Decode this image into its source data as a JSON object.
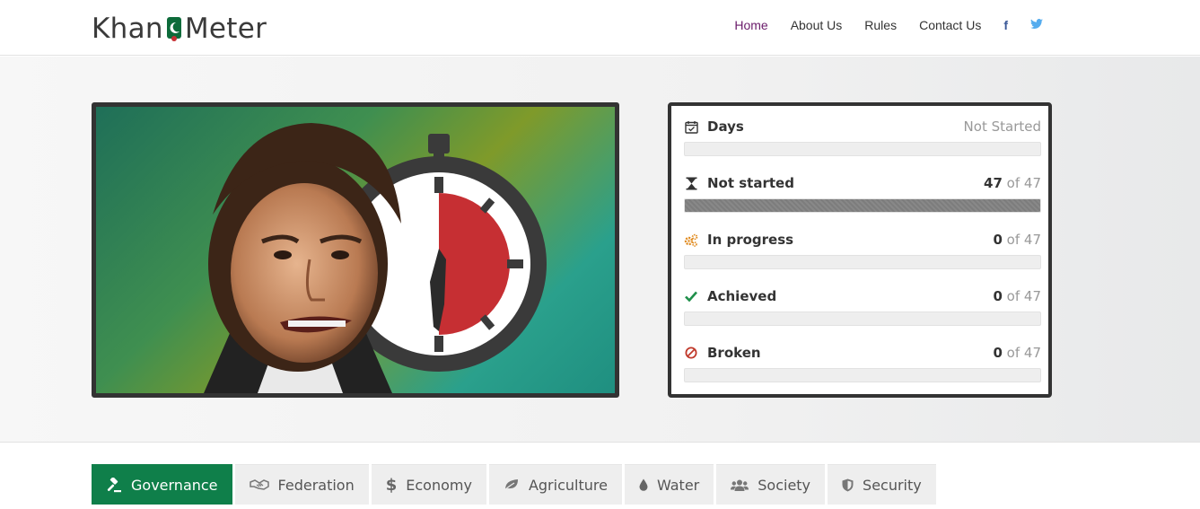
{
  "header": {
    "logo": {
      "left": "Khan",
      "right": "Meter"
    },
    "nav": [
      {
        "label": "Home",
        "active": true
      },
      {
        "label": "About Us",
        "active": false
      },
      {
        "label": "Rules",
        "active": false
      },
      {
        "label": "Contact Us",
        "active": false
      }
    ],
    "social": [
      {
        "glyph": "f",
        "icon": "facebook-icon",
        "color": "#3b5998"
      },
      {
        "glyph": "🐦",
        "icon": "twitter-icon",
        "color": "#55acee"
      }
    ]
  },
  "stats": {
    "days": {
      "label": "Days",
      "value": "Not Started",
      "icon": "calendar-icon",
      "progress": 0
    },
    "rows": [
      {
        "label": "Not started",
        "count": "47",
        "of": "of 47",
        "icon": "hourglass-icon",
        "color": "#333333",
        "progress": 1.0
      },
      {
        "label": "In progress",
        "count": "0",
        "of": "of 47",
        "icon": "gears-icon",
        "color": "#e08a1e",
        "progress": 0
      },
      {
        "label": "Achieved",
        "count": "0",
        "of": "of 47",
        "icon": "check-icon",
        "color": "#1f8f4a",
        "progress": 0
      },
      {
        "label": "Broken",
        "count": "0",
        "of": "of 47",
        "icon": "ban-icon",
        "color": "#c0392b",
        "progress": 0
      }
    ]
  },
  "tabs": [
    {
      "label": "Governance",
      "icon": "gavel-icon",
      "active": true
    },
    {
      "label": "Federation",
      "icon": "handshake-icon",
      "active": false
    },
    {
      "label": "Economy",
      "icon": "dollar-icon",
      "active": false
    },
    {
      "label": "Agriculture",
      "icon": "leaf-icon",
      "active": false
    },
    {
      "label": "Water",
      "icon": "drop-icon",
      "active": false
    },
    {
      "label": "Society",
      "icon": "users-icon",
      "active": false
    },
    {
      "label": "Security",
      "icon": "shield-icon",
      "active": false
    }
  ],
  "colors": {
    "accent": "#0f7f4a",
    "nav_active": "#6a1b6a",
    "timer_red": "#c62f33"
  }
}
